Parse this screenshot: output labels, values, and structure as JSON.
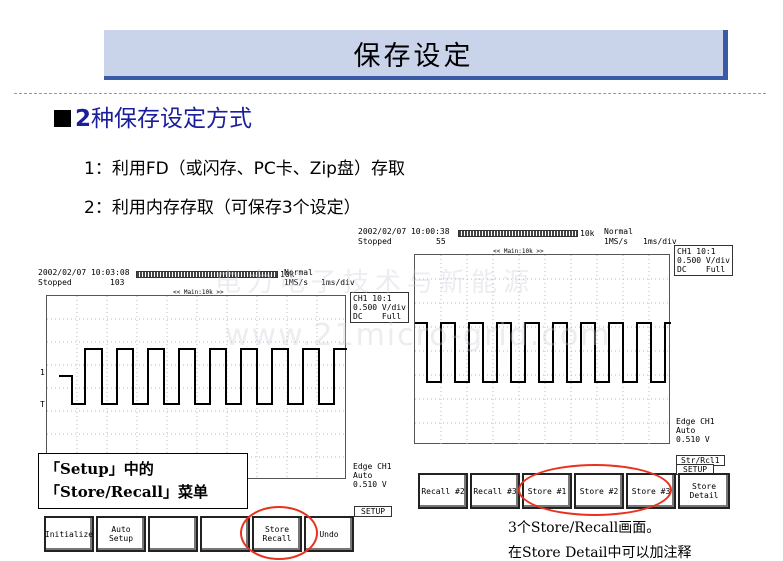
{
  "title": "保存设定",
  "heading": {
    "prefix": "2",
    "text": "种保存设定方式"
  },
  "lines": [
    "1：利用FD（或闪存、PC卡、Zip盘）存取",
    "2：利用内存存取（可保存3个设定）"
  ],
  "watermark": {
    "cn": "电力电子技术与新能源",
    "url": "www.21micro-grid.com"
  },
  "scope_left": {
    "datetime": "2002/02/07 10:03:08",
    "status": "Stopped",
    "count": "103",
    "mode": "Normal",
    "rate": "1MS/s",
    "timediv": "1ms/div",
    "record_length": "10k",
    "main_label": "<< Main:10k >>",
    "ch_info": [
      "CH1 10:1",
      "0.500 V/div",
      "DC    Full"
    ],
    "trigger_info": [
      "Edge CH1",
      "Auto",
      "0.510 V"
    ],
    "menu_tab": "SETUP",
    "softkeys": [
      "Initialize",
      "Auto\nSetup",
      "",
      "",
      "Store\nRecall",
      "Undo"
    ]
  },
  "scope_right": {
    "datetime": "2002/02/07 10:00:38",
    "status": "Stopped",
    "count": "55",
    "mode": "Normal",
    "rate": "1MS/s",
    "timediv": "1ms/div",
    "record_length": "10k",
    "main_label": "<< Main:10k >>",
    "ch_info": [
      "CH1 10:1",
      "0.500 V/div",
      "DC    Full"
    ],
    "trigger_info": [
      "Edge CH1",
      "Auto",
      "0.510 V"
    ],
    "menu_tabs": [
      "Str/Rcl1",
      "SETUP"
    ],
    "softkeys": [
      "Recall #2",
      "Recall #3",
      "Store #1",
      "Store #2",
      "Store #3",
      "Store\nDetail"
    ]
  },
  "callout": {
    "line1": "「Setup」中的",
    "line2": "「Store/Recall」菜单"
  },
  "notes": {
    "line1": "3个Store/Recall画面。",
    "line2": "在Store   Detail中可以加注释"
  },
  "colors": {
    "accent": "#3a5aa8",
    "banner": "#c9d3ea",
    "heading": "#1a1e9a",
    "highlight": "#e8321e"
  }
}
